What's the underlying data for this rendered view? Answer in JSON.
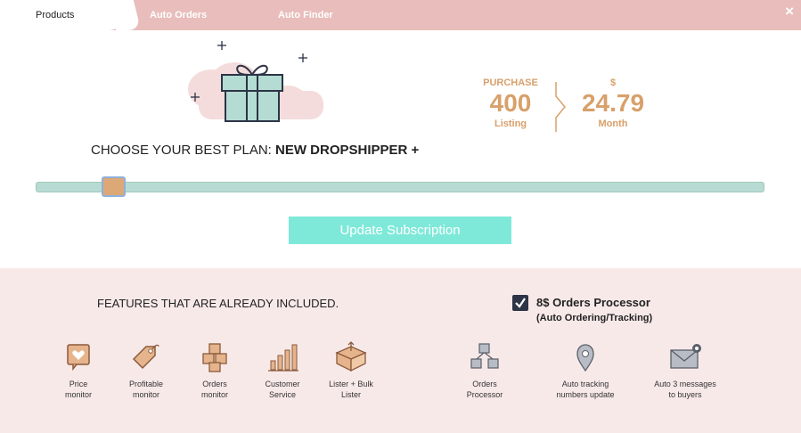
{
  "tabs": [
    {
      "label": "Products",
      "active": true
    },
    {
      "label": "Auto Orders",
      "active": false
    },
    {
      "label": "Auto Finder",
      "active": false
    }
  ],
  "close_symbol": "×",
  "price": {
    "left_top": "PURCHASE",
    "left_value": "400",
    "left_unit": "Listing",
    "right_top": "$",
    "right_value": "24.79",
    "right_unit": "Month"
  },
  "plan": {
    "label": "CHOOSE YOUR BEST PLAN:",
    "name": "NEW DROPSHIPPER +"
  },
  "slider": {
    "level_fraction": 0.09
  },
  "update_button": "Update Subscription",
  "features": {
    "heading": "FEATURES THAT ARE ALREADY INCLUDED.",
    "addon": {
      "checked": true,
      "label": "8$ Orders Processor",
      "sublabel": "(Auto Ordering/Tracking)"
    },
    "items": [
      {
        "icon": "price-monitor-icon",
        "label": "Price\nmonitor"
      },
      {
        "icon": "profitable-monitor-icon",
        "label": "Profitable\nmonitor"
      },
      {
        "icon": "orders-monitor-icon",
        "label": "Orders\nmonitor"
      },
      {
        "icon": "customer-service-icon",
        "label": "Customer\nService"
      },
      {
        "icon": "lister-icon",
        "label": "Lister + Bulk\nLister"
      },
      {
        "icon": "orders-processor-icon",
        "label": "Orders\nProcessor"
      },
      {
        "icon": "location-pin-icon",
        "label": "Auto tracking\nnumbers update"
      },
      {
        "icon": "envelope-icon",
        "label": "Auto 3 messages\nto buyers"
      }
    ]
  },
  "colors": {
    "tab_bar": "#e8bdbb",
    "accent": "#d8a06a",
    "slider_track": "#b7dbd2",
    "button": "#7fe9d9",
    "features_bg": "#f8e9e9"
  }
}
